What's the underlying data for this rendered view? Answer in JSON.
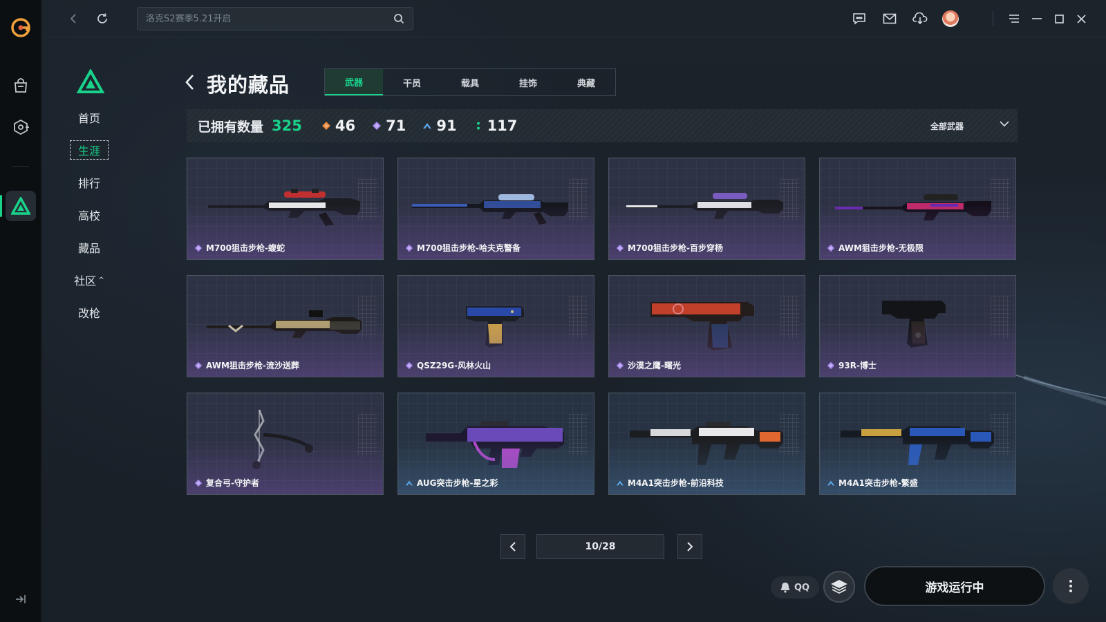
{
  "search": {
    "placeholder": "洛克S2赛季5.21开启"
  },
  "sidebar": {
    "items": [
      {
        "label": "首页"
      },
      {
        "label": "生涯"
      },
      {
        "label": "排行"
      },
      {
        "label": "高校"
      },
      {
        "label": "藏品"
      },
      {
        "label": "社区",
        "caret": "^"
      },
      {
        "label": "改枪"
      }
    ],
    "active_index": 1
  },
  "collection": {
    "title": "我的藏品",
    "tabs": [
      "武器",
      "干员",
      "载具",
      "挂饰",
      "典藏"
    ],
    "active_tab": 0,
    "owned_label": "已拥有数量",
    "owned_count": "325",
    "rarity_counts": [
      {
        "icon": "orange-diamond-icon",
        "color": "#e8873a",
        "value": "46"
      },
      {
        "icon": "purple-diamond-icon",
        "color": "#a98cf0",
        "value": "71"
      },
      {
        "icon": "blue-chevron-icon",
        "color": "#5aa7e6",
        "value": "91"
      },
      {
        "icon": "green-dots-icon",
        "color": "#19d38b",
        "value": "117"
      }
    ],
    "filter_label": "全部武器"
  },
  "items": [
    {
      "name": "M700狙击步枪-蝮蛇",
      "rarity": "epic"
    },
    {
      "name": "M700狙击步枪-哈夫克警备",
      "rarity": "epic"
    },
    {
      "name": "M700狙击步枪-百步穿杨",
      "rarity": "epic"
    },
    {
      "name": "AWM狙击步枪-无极限",
      "rarity": "epic"
    },
    {
      "name": "AWM狙击步枪-流沙送葬",
      "rarity": "epic"
    },
    {
      "name": "QSZ29G-风林火山",
      "rarity": "epic"
    },
    {
      "name": "沙漠之鹰-曙光",
      "rarity": "epic"
    },
    {
      "name": "93R-博士",
      "rarity": "epic"
    },
    {
      "name": "复合弓-守护者",
      "rarity": "epic"
    },
    {
      "name": "AUG突击步枪-星之彩",
      "rarity": "rare"
    },
    {
      "name": "M4A1突击步枪-前沿科技",
      "rarity": "rare"
    },
    {
      "name": "M4A1突击步枪-繁盛",
      "rarity": "rare"
    }
  ],
  "pagination": {
    "current": "10/28"
  },
  "footer": {
    "qq_label": "QQ",
    "run_label": "游戏运行中"
  },
  "colors": {
    "accent": "#19d38b",
    "epic": "#a98cf0",
    "rare": "#5aa7e6"
  }
}
